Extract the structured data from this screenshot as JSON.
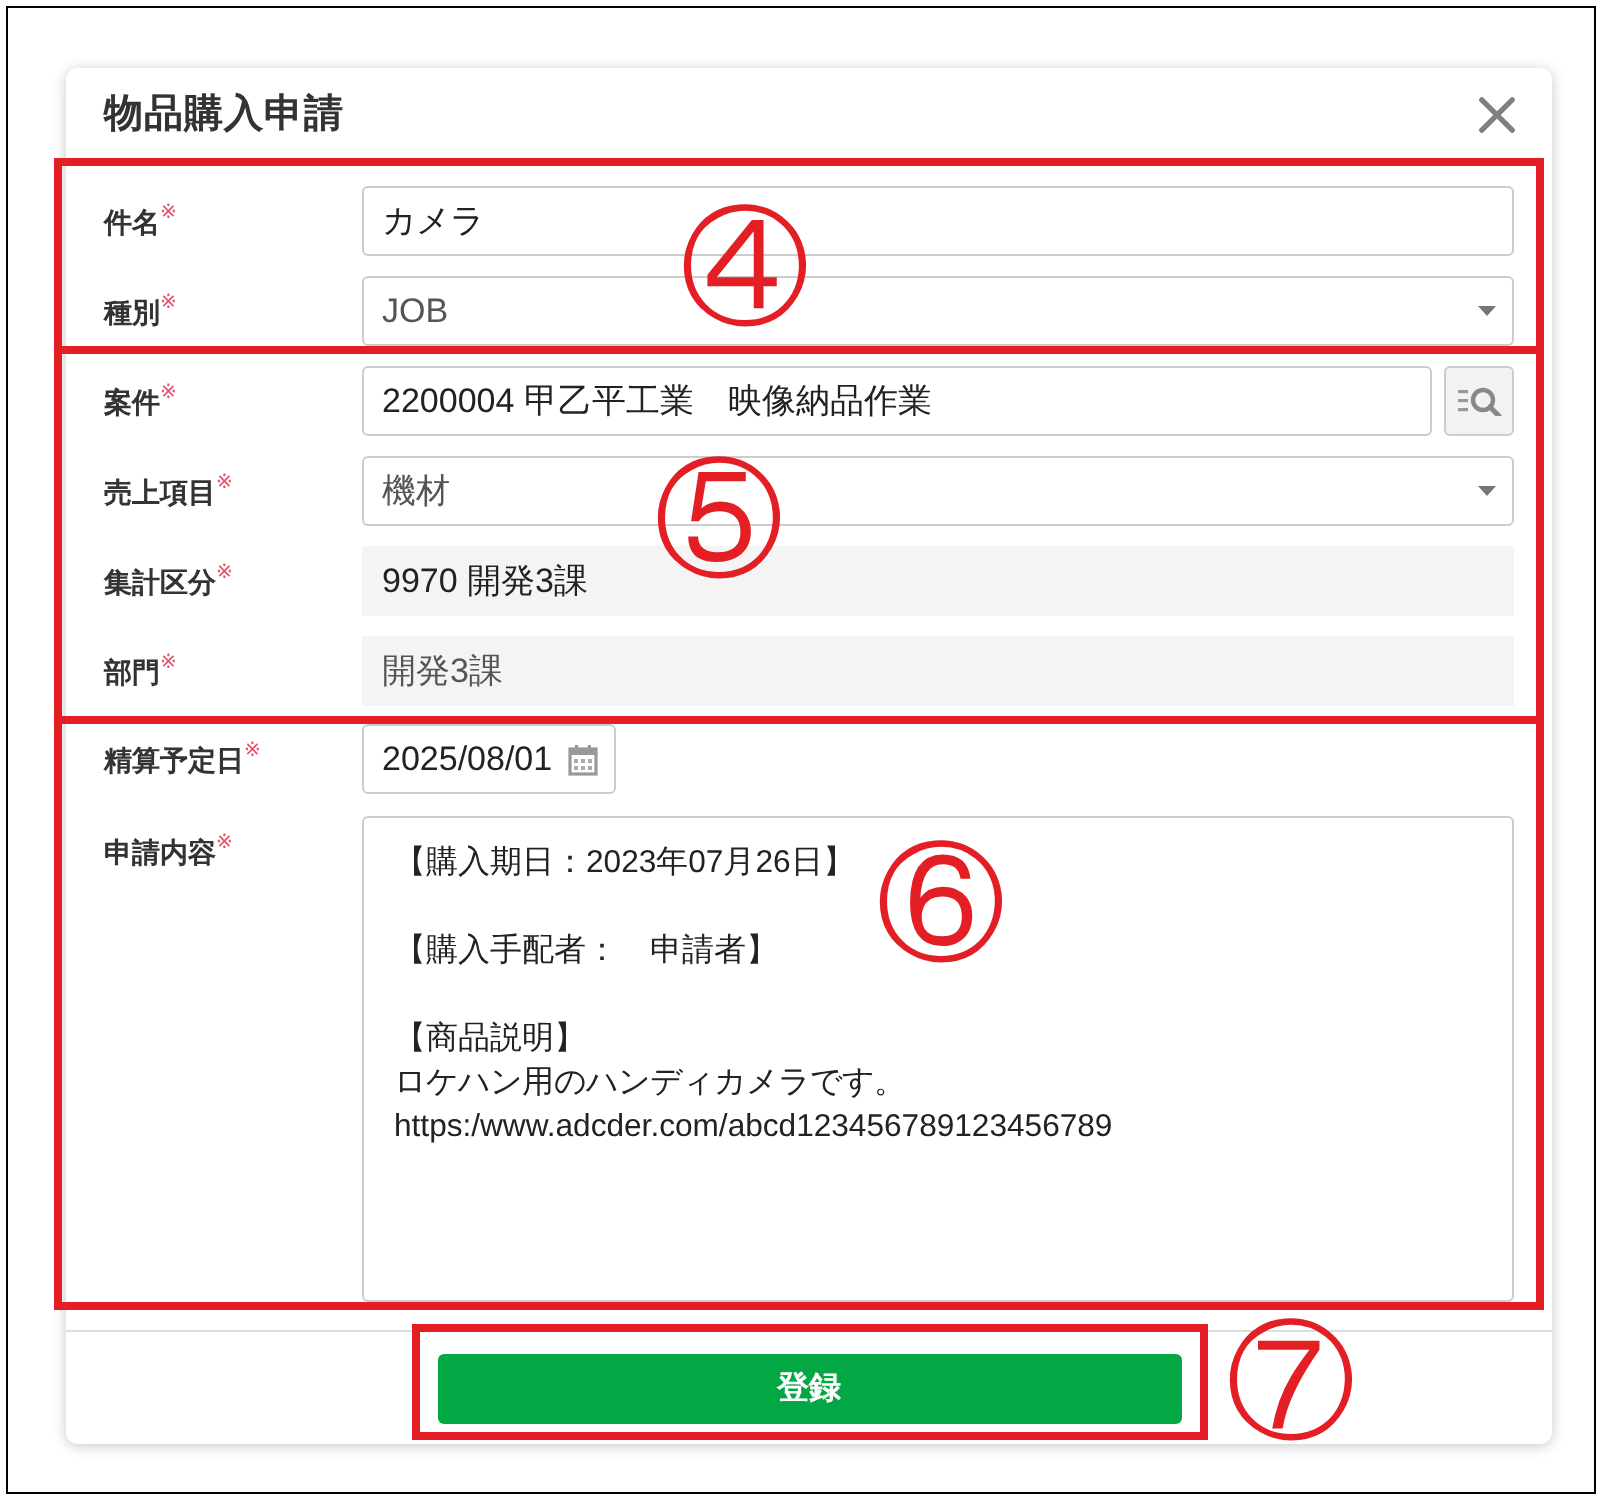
{
  "dialog": {
    "title": "物品購入申請"
  },
  "sections": [
    {
      "marker": "④",
      "fields": [
        {
          "kind": "text",
          "label": "件名$^{※}$",
          "value": "カメラ"
        },
        {
          "kind": "select",
          "label": "種別$^{※}$",
          "value": "JOB"
        }
      ]
    },
    {
      "marker": "⑤",
      "fields": [
        {
          "kind": "lookup",
          "label": "案件$^{※}$",
          "value": "2200004 甲乙平工業　映像納品作業"
        },
        {
          "kind": "select",
          "label": "売上項目$^{※}$",
          "value": "機材"
        },
        {
          "kind": "readonly",
          "label": "集計区分$^{※}$",
          "value": "9970 開発3課"
        },
        {
          "kind": "disabled",
          "label": "部門$^{※}$",
          "value": "開発3課"
        }
      ]
    },
    {
      "marker": "⑥",
      "fields": [
        {
          "kind": "date",
          "label": "精算予定日$^{※}$",
          "value": "2025/08/01"
        },
        {
          "kind": "textarea",
          "label": "申請内容$^{※}$",
          "paragraphs": [
            [
              "【購入期日：2023年07月26日】"
            ],
            [
              "【購入手配者：　申請者】"
            ],
            [
              "【商品説明】",
              "ロケハン用のハンディカメラです。",
              "https:/www.adcder.com/abcd123456789123456789"
            ]
          ]
        }
      ]
    }
  ],
  "footer": {
    "marker": "⑦",
    "submit_button": "登録"
  }
}
